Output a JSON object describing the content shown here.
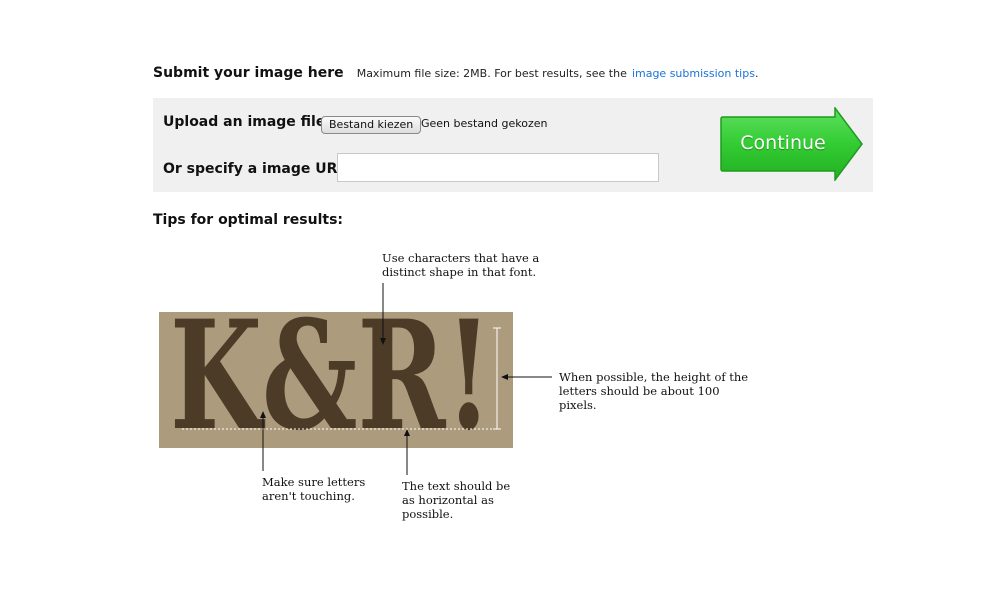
{
  "header": {
    "title": "Submit your image here",
    "note": "Maximum file size: 2MB. For best results, see the",
    "link": "image submission tips",
    "suffix": "."
  },
  "upload": {
    "file_label": "Upload an image file:",
    "file_button": "Bestand kiezen",
    "file_status": "Geen bestand gekozen",
    "url_label": "Or specify a image URL:",
    "url_value": "",
    "continue_label": "Continue"
  },
  "tips": {
    "title": "Tips for optimal results:",
    "sample_text": "K&R!",
    "tip_shape_line1": "Use characters that have a",
    "tip_shape_line2": "distinct shape in that font.",
    "tip_height_line1": "When possible, the height of the",
    "tip_height_line2": "letters should be about 100",
    "tip_height_line3": "pixels.",
    "tip_touching_line1": "Make sure letters",
    "tip_touching_line2": "aren't touching.",
    "tip_horizontal_line1": "The text should be",
    "tip_horizontal_line2": "as horizontal as",
    "tip_horizontal_line3": "possible."
  },
  "colors": {
    "panel_bg": "#f0f0f0",
    "link": "#1a73d9",
    "continue_green": "#33cc33",
    "sample_bg": "#ad9b7e",
    "sample_letters": "#4b3b27"
  }
}
